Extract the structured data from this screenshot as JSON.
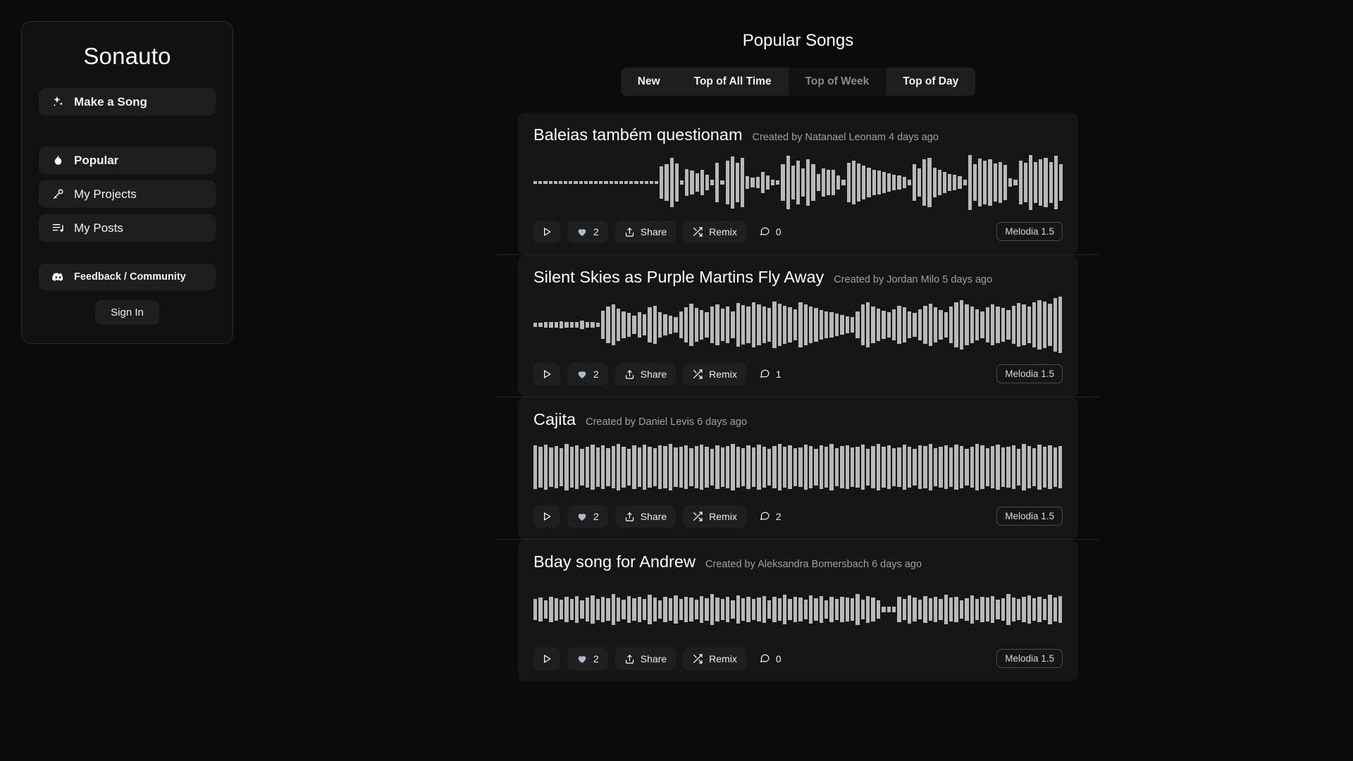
{
  "brand": "Sonauto",
  "sidebar": {
    "primary": {
      "label": "Make a Song",
      "icon": "sparkles-icon"
    },
    "items": [
      {
        "label": "Popular",
        "icon": "flame-icon",
        "active": true
      },
      {
        "label": "My Projects",
        "icon": "microphone-icon",
        "active": false
      },
      {
        "label": "My Posts",
        "icon": "playlist-icon",
        "active": false
      }
    ],
    "discord": {
      "label": "Feedback / Community",
      "icon": "discord-icon"
    },
    "signin": "Sign In"
  },
  "header": {
    "title": "Popular Songs"
  },
  "tabs": [
    {
      "label": "New",
      "state": "raised"
    },
    {
      "label": "Top of All Time",
      "state": "raised"
    },
    {
      "label": "Top of Week",
      "state": "dim"
    },
    {
      "label": "Top of Day",
      "state": "raised"
    }
  ],
  "actions": {
    "play": "play-icon",
    "share": "Share",
    "remix": "Remix"
  },
  "songs": [
    {
      "title": "Baleias também questionam",
      "meta": "Created by Natanael Leonam 4 days ago",
      "likes": "2",
      "comments": "0",
      "model": "Melodia 1.5",
      "liked": true,
      "wave": [
        4,
        4,
        4,
        4,
        4,
        4,
        4,
        4,
        4,
        4,
        4,
        4,
        4,
        4,
        4,
        4,
        4,
        4,
        4,
        4,
        4,
        4,
        4,
        4,
        4,
        52,
        60,
        80,
        62,
        6,
        44,
        38,
        30,
        40,
        24,
        10,
        64,
        6,
        70,
        84,
        64,
        80,
        20,
        16,
        18,
        34,
        22,
        8,
        6,
        58,
        86,
        54,
        70,
        46,
        74,
        60,
        28,
        46,
        42,
        40,
        22,
        8,
        64,
        70,
        62,
        54,
        48,
        42,
        38,
        34,
        30,
        26,
        22,
        18,
        8,
        58,
        46,
        74,
        80,
        48,
        40,
        34,
        28,
        24,
        20,
        8,
        88,
        60,
        78,
        70,
        76,
        62,
        66,
        56,
        14,
        8,
        70,
        64,
        88,
        66,
        74,
        80,
        66,
        86,
        60
      ]
    },
    {
      "title": "Silent Skies as Purple Martins Fly Away",
      "meta": "Created by Jordan Milo 5 days ago",
      "likes": "2",
      "comments": "1",
      "model": "Melodia 1.5",
      "liked": true,
      "wave": [
        6,
        6,
        8,
        8,
        10,
        12,
        10,
        8,
        8,
        14,
        10,
        8,
        6,
        46,
        58,
        66,
        52,
        44,
        38,
        30,
        40,
        34,
        56,
        62,
        40,
        34,
        30,
        26,
        44,
        56,
        68,
        54,
        48,
        42,
        60,
        66,
        52,
        58,
        44,
        70,
        64,
        58,
        72,
        66,
        60,
        54,
        74,
        68,
        62,
        56,
        50,
        72,
        66,
        60,
        54,
        48,
        44,
        40,
        36,
        32,
        28,
        24,
        44,
        66,
        72,
        58,
        52,
        46,
        40,
        50,
        62,
        56,
        44,
        38,
        50,
        62,
        68,
        56,
        48,
        42,
        60,
        72,
        80,
        66,
        58,
        50,
        44,
        56,
        66,
        60,
        54,
        48,
        62,
        70,
        66,
        58,
        72,
        80,
        74,
        68,
        86,
        92
      ]
    },
    {
      "title": "Cajita",
      "meta": "Created by Daniel Levis 6 days ago",
      "likes": "2",
      "comments": "2",
      "model": "Melodia 1.5",
      "liked": true,
      "wave": [
        70,
        66,
        72,
        64,
        68,
        62,
        74,
        66,
        70,
        60,
        66,
        72,
        64,
        70,
        62,
        68,
        74,
        66,
        60,
        70,
        64,
        72,
        66,
        62,
        70,
        68,
        74,
        64,
        66,
        70,
        62,
        68,
        72,
        66,
        60,
        70,
        64,
        68,
        74,
        66,
        62,
        70,
        64,
        72,
        66,
        60,
        68,
        74,
        66,
        70,
        62,
        64,
        72,
        68,
        60,
        70,
        66,
        74,
        62,
        68,
        70,
        64,
        66,
        72,
        60,
        68,
        74,
        66,
        70,
        62,
        64,
        72,
        66,
        60,
        70,
        68,
        74,
        62,
        66,
        70,
        64,
        72,
        68,
        60,
        66,
        74,
        70,
        62,
        68,
        72,
        64,
        66,
        70,
        60,
        74,
        68,
        62,
        72,
        66,
        70,
        64,
        68
      ]
    },
    {
      "title": "Bday song for Andrew",
      "meta": "Created by Aleksandra Bomersbach 6 days ago",
      "likes": "2",
      "comments": "0",
      "model": "Melodia 1.5",
      "liked": true,
      "wave": [
        34,
        38,
        30,
        42,
        36,
        32,
        40,
        34,
        44,
        30,
        38,
        46,
        34,
        40,
        36,
        50,
        38,
        32,
        44,
        36,
        40,
        34,
        48,
        38,
        30,
        42,
        36,
        46,
        34,
        40,
        38,
        32,
        44,
        36,
        50,
        38,
        34,
        42,
        30,
        46,
        36,
        40,
        34,
        38,
        44,
        30,
        42,
        36,
        48,
        34,
        40,
        38,
        32,
        46,
        36,
        44,
        30,
        40,
        34,
        42,
        38,
        36,
        50,
        32,
        44,
        38,
        30,
        8,
        8,
        10,
        40,
        34,
        46,
        38,
        32,
        44,
        36,
        40,
        34,
        48,
        38,
        42,
        30,
        36,
        46,
        34,
        40,
        38,
        44,
        32,
        36,
        50,
        38,
        34,
        42,
        46,
        36,
        40,
        34,
        48,
        38,
        44
      ]
    }
  ],
  "colors": {
    "page_bg": "#0b0b0b",
    "card_bg": "#161616",
    "accent_heart": "#a9bccb",
    "wave": "#b8b8b8"
  }
}
